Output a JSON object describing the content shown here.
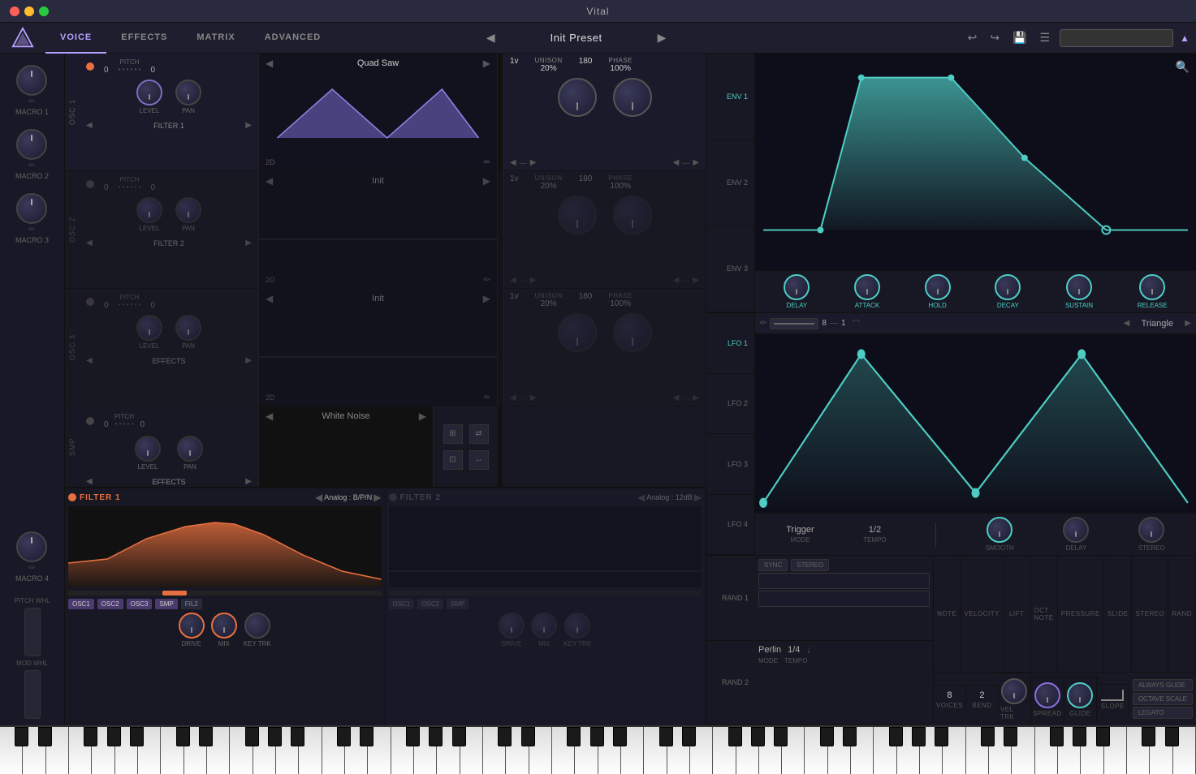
{
  "app": {
    "title": "Vital"
  },
  "navbar": {
    "tabs": [
      "VOICE",
      "EFFECTS",
      "MATRIX",
      "ADVANCED"
    ],
    "active_tab": "VOICE",
    "preset_name": "Init Preset",
    "prev_icon": "◀",
    "next_icon": "▶"
  },
  "macros": [
    {
      "label": "MACRO 1"
    },
    {
      "label": "MACRO 2"
    },
    {
      "label": "MACRO 3"
    },
    {
      "label": "MACRO 4"
    }
  ],
  "oscillators": [
    {
      "id": "OSC 1",
      "enabled": true,
      "pitch_label": "PITCH",
      "pitch_left": "0",
      "pitch_right": "0",
      "wave_name": "Quad Saw",
      "dim": "2D",
      "filter_label": "FILTER 1",
      "unison_label": "UNISON",
      "unison_val": "20%",
      "phase_label": "PHASE",
      "phase_val": "100%",
      "voices": "1v",
      "detune": "180",
      "level_label": "LEVEL",
      "pan_label": "PAN"
    },
    {
      "id": "OSC 2",
      "enabled": false,
      "pitch_label": "PITCH",
      "pitch_left": "0",
      "pitch_right": "0",
      "wave_name": "Init",
      "dim": "2D",
      "filter_label": "FILTER 2",
      "unison_label": "UNISON",
      "unison_val": "20%",
      "phase_label": "PHASE",
      "phase_val": "100%",
      "voices": "1v",
      "detune": "180",
      "level_label": "LEVEL",
      "pan_label": "PAN"
    },
    {
      "id": "OSC 3",
      "enabled": false,
      "pitch_label": "PITCH",
      "pitch_left": "0",
      "pitch_right": "0",
      "wave_name": "Init",
      "dim": "2D",
      "filter_label": "EFFECTS",
      "unison_label": "UNISON",
      "unison_val": "20%",
      "phase_label": "PHASE",
      "phase_val": "100%",
      "voices": "1v",
      "detune": "180",
      "level_label": "LEVEL",
      "pan_label": "PAN"
    }
  ],
  "sample": {
    "id": "SMP",
    "wave_name": "White Noise",
    "filter_label": "EFFECTS"
  },
  "filters": [
    {
      "id": "FILTER 1",
      "enabled": true,
      "type": "Analog : B/P/N",
      "tags": [
        "OSC1",
        "OSC2",
        "OSC3",
        "SMP",
        "FIL2"
      ],
      "drive_label": "DRIVE",
      "mix_label": "MIX",
      "keytrack_label": "KEY TRK"
    },
    {
      "id": "FILTER 2",
      "enabled": false,
      "type": "Analog : 12dB",
      "tags": [
        "OSC1",
        "OSC2",
        "SMP"
      ],
      "drive_label": "DRIVE",
      "mix_label": "MIX",
      "keytrack_label": "KEY TRK"
    }
  ],
  "envelopes": {
    "labels": [
      "ENV 1",
      "ENV 2",
      "ENV 3"
    ],
    "active": "ENV 1",
    "knobs": [
      {
        "label": "DELAY"
      },
      {
        "label": "ATTACK"
      },
      {
        "label": "HOLD"
      },
      {
        "label": "DECAY"
      },
      {
        "label": "SUSTAIN"
      },
      {
        "label": "RELEASE"
      }
    ]
  },
  "lfos": {
    "labels": [
      "LFO 1",
      "LFO 2",
      "LFO 3",
      "LFO 4"
    ],
    "active": "LFO 1",
    "shape": "Triangle",
    "header_vals": [
      "8",
      "1"
    ],
    "footer": {
      "mode": "Trigger",
      "mode_label": "MODE",
      "tempo": "1/2",
      "tempo_label": "TEMPO",
      "smooth_label": "SMOOTH",
      "delay_label": "DELAY",
      "stereo_label": "STEREO"
    }
  },
  "rand": [
    {
      "label": "RAND 1",
      "btn1": "SYNC",
      "btn2": "STEREO"
    },
    {
      "label": "RAND 2",
      "mode": "Perlin",
      "mode_label": "MODE",
      "tempo": "1/4",
      "tempo_label": "TEMPO"
    }
  ],
  "modulation": {
    "cols": [
      {
        "label": "NOTE"
      },
      {
        "label": "VELOCITY"
      },
      {
        "label": "LIFT"
      },
      {
        "label": "OCT NOTE"
      },
      {
        "label": "PRESSURE"
      },
      {
        "label": "SLIDE"
      },
      {
        "label": "STEREO"
      },
      {
        "label": "RAND"
      }
    ]
  },
  "voice": {
    "voices_val": "8",
    "voices_label": "VOICES",
    "bend_val": "2",
    "bend_label": "BEND",
    "veltrk_label": "VEL TRK",
    "spread_label": "SPREAD",
    "glide_label": "GLIDE",
    "slope_label": "SLOPE",
    "always_glide": "ALWAYS GLIDE",
    "octave_scale": "OCTAVE SCALE",
    "legato": "LEGATO"
  }
}
